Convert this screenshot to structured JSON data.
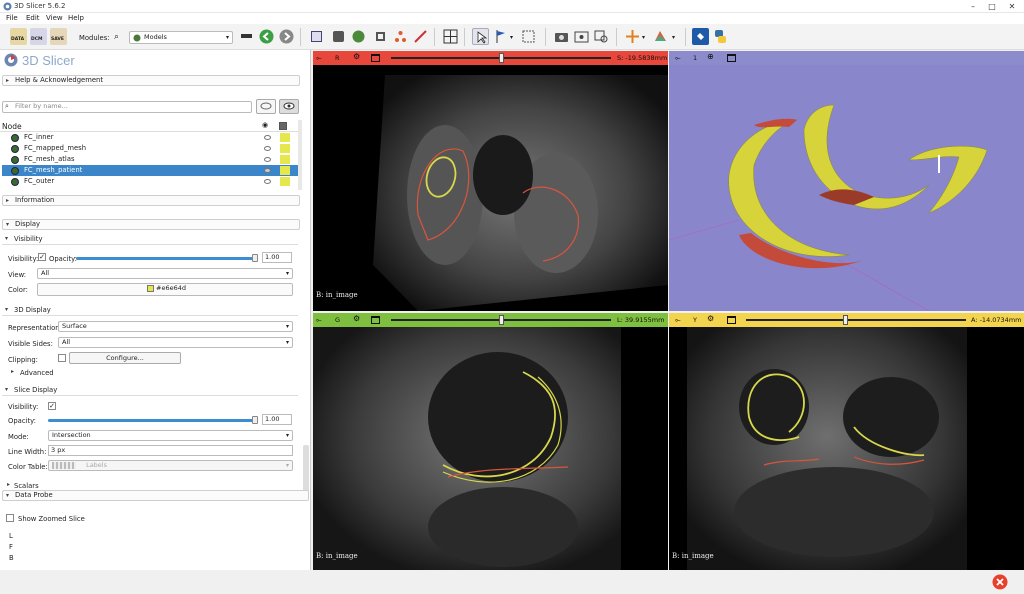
{
  "window": {
    "title": "3D Slicer 5.6.2",
    "minimize": "–",
    "maximize": "□",
    "close": "✕"
  },
  "menu": [
    "File",
    "Edit",
    "View",
    "Help"
  ],
  "toolbar": {
    "modules_label": "Modules:",
    "module_selected": "Models",
    "data_label": "DATA",
    "dcm_label": "DCM",
    "save_label": "SAVE"
  },
  "logo": {
    "text": "3D Slicer"
  },
  "help_section": "Help & Acknowledgement",
  "filter_placeholder": "Filter by name...",
  "tree": {
    "header": "Node",
    "items": [
      "FC_inner",
      "FC_mapped_mesh",
      "FC_mesh_atlas",
      "FC_mesh_patient",
      "FC_outer"
    ],
    "selected_index": 3
  },
  "information": "Information",
  "display": {
    "title": "Display",
    "visibility_section": "Visibility",
    "visibility_label": "Visibility:",
    "opacity_label": "Opacity:",
    "opacity_value": "1.00",
    "opacity_level": 1.0,
    "view_label": "View:",
    "view_value": "All",
    "color_label": "Color:",
    "color_value": "#e6e64d",
    "d3_section": "3D Display",
    "representation_label": "Representation:",
    "representation_value": "Surface",
    "visible_sides_label": "Visible Sides:",
    "visible_sides_value": "All",
    "clipping_label": "Clipping:",
    "configure_label": "Configure...",
    "advanced_label": "Advanced",
    "slice_section": "Slice Display",
    "s_visibility_label": "Visibility:",
    "s_opacity_label": "Opacity:",
    "s_opacity_value": "1.00",
    "mode_label": "Mode:",
    "mode_value": "Intersection",
    "line_width_label": "Line Width:",
    "line_width_value": "3 px",
    "color_table_label": "Color Table:",
    "color_table_value": "Labels",
    "scalars_label": "Scalars"
  },
  "data_probe": {
    "title": "Data Probe",
    "show_zoomed": "Show Zoomed Slice",
    "lines": [
      "L",
      "F",
      "B"
    ]
  },
  "views": {
    "red": {
      "letter": "R",
      "value": "S: -19.5838mm",
      "label": "B: in_image",
      "slider_level": 0.5,
      "color": "#e8473b"
    },
    "threeD": {
      "letter": "1",
      "color": "#8c8ccc"
    },
    "green": {
      "letter": "G",
      "value": "L: 39.9155mm",
      "label": "B: in_image",
      "slider_level": 0.5,
      "color": "#7fbf3f"
    },
    "yellow": {
      "letter": "Y",
      "value": "A: -14.0734mm",
      "label": "B: in_image",
      "slider_level": 0.45,
      "color": "#f2d44f"
    }
  },
  "colors": {
    "accent": "#3d8ed0",
    "segment_yellow": "#e6e64d",
    "segment_red": "#d9553d",
    "threeD_bg": "#8a86cc"
  }
}
